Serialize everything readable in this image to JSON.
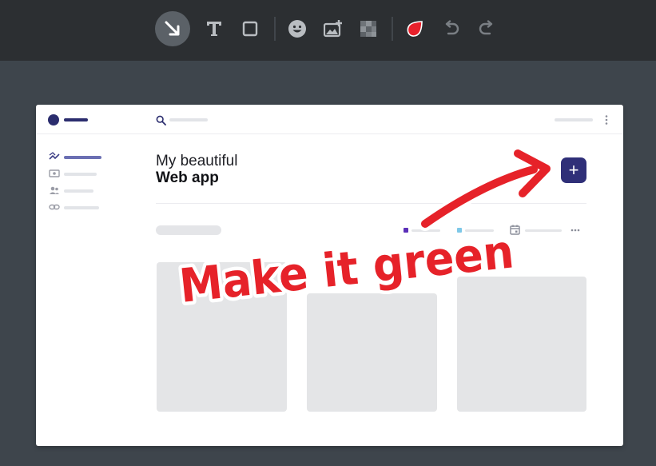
{
  "toolbar": {
    "tools": [
      {
        "name": "arrow-tool",
        "icon": "arrow-down-right-icon",
        "active": true
      },
      {
        "name": "text-tool",
        "icon": "text-T-icon"
      },
      {
        "name": "rectangle-tool",
        "icon": "square-icon"
      },
      {
        "name": "emoji-tool",
        "icon": "smiley-icon"
      },
      {
        "name": "image-tool",
        "icon": "add-image-icon"
      },
      {
        "name": "pixelate-tool",
        "icon": "pixelate-icon"
      },
      {
        "name": "color-tool",
        "icon": "red-drop-icon"
      },
      {
        "name": "undo-tool",
        "icon": "undo-icon"
      },
      {
        "name": "redo-tool",
        "icon": "redo-icon"
      }
    ],
    "active_color": "#e8202b"
  },
  "app": {
    "title_line1": "My beautiful",
    "title_line2": "Web app",
    "add_button_label": "+",
    "brand_color": "#2f2f78"
  },
  "annotation": {
    "text": "Make it green",
    "color": "#e62229"
  }
}
